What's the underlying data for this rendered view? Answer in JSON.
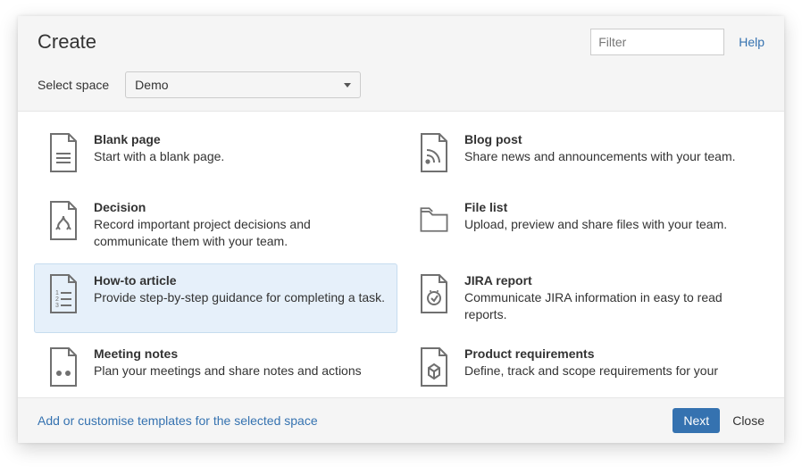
{
  "header": {
    "title": "Create",
    "filter_placeholder": "Filter",
    "help_label": "Help",
    "select_space_label": "Select space",
    "selected_space": "Demo"
  },
  "templates": [
    {
      "id": "blank-page",
      "icon": "blank-page-icon",
      "title": "Blank page",
      "desc": "Start with a blank page.",
      "selected": false
    },
    {
      "id": "blog-post",
      "icon": "blog-post-icon",
      "title": "Blog post",
      "desc": "Share news and announcements with your team.",
      "selected": false
    },
    {
      "id": "decision",
      "icon": "decision-icon",
      "title": "Decision",
      "desc": "Record important project decisions and communicate them with your team.",
      "selected": false
    },
    {
      "id": "file-list",
      "icon": "file-list-icon",
      "title": "File list",
      "desc": "Upload, preview and share files with your team.",
      "selected": false
    },
    {
      "id": "how-to-article",
      "icon": "how-to-icon",
      "title": "How-to article",
      "desc": "Provide step-by-step guidance for completing a task.",
      "selected": true
    },
    {
      "id": "jira-report",
      "icon": "jira-report-icon",
      "title": "JIRA report",
      "desc": "Communicate JIRA information in easy to read reports.",
      "selected": false
    },
    {
      "id": "meeting-notes",
      "icon": "meeting-notes-icon",
      "title": "Meeting notes",
      "desc": "Plan your meetings and share notes and actions",
      "selected": false
    },
    {
      "id": "product-requirements",
      "icon": "product-requirements-icon",
      "title": "Product requirements",
      "desc": "Define, track and scope requirements for your",
      "selected": false
    }
  ],
  "footer": {
    "customise_link": "Add or customise templates for the selected space",
    "next_label": "Next",
    "close_label": "Close"
  }
}
